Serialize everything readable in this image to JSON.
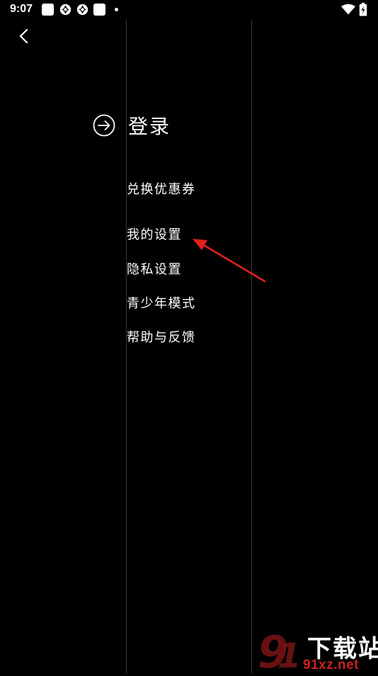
{
  "status_bar": {
    "time": "9:07"
  },
  "login": {
    "label": "登录",
    "icon": "arrow-right-circle-icon"
  },
  "menu": {
    "items": [
      {
        "label": "兑换优惠券"
      },
      {
        "label": "我的设置"
      },
      {
        "label": "隐私设置"
      },
      {
        "label": "青少年模式"
      },
      {
        "label": "帮助与反馈"
      }
    ]
  },
  "watermark": {
    "text_cn": "下载站",
    "text_en": "91xz.net"
  },
  "colors": {
    "background": "#000000",
    "text": "#ffffff",
    "divider": "#3a3a3a",
    "annotation": "#e0201e"
  }
}
